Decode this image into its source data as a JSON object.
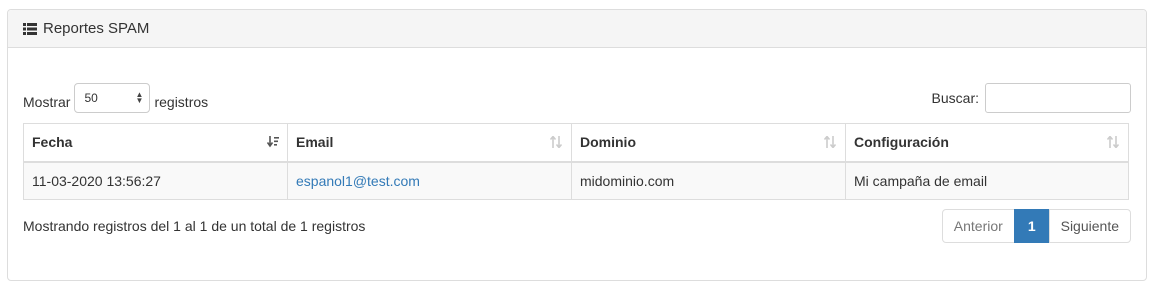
{
  "panel": {
    "title": "Reportes SPAM",
    "title_icon": "list-icon"
  },
  "length": {
    "prefix": "Mostrar",
    "value": "50",
    "suffix": "registros"
  },
  "filter": {
    "label": "Buscar:",
    "value": ""
  },
  "table": {
    "columns": [
      {
        "label": "Fecha",
        "sort": "sorted-desc"
      },
      {
        "label": "Email",
        "sort": "sortable"
      },
      {
        "label": "Dominio",
        "sort": "sortable"
      },
      {
        "label": "Configuración",
        "sort": "sortable"
      }
    ],
    "rows": [
      {
        "fecha": "11-03-2020 13:56:27",
        "email": "espanol1@test.com",
        "dominio": "midominio.com",
        "configuracion": "Mi campaña de email"
      }
    ]
  },
  "info": "Mostrando registros del 1 al 1 de un total de 1 registros",
  "pagination": {
    "previous": "Anterior",
    "current": "1",
    "next": "Siguiente"
  },
  "colors": {
    "accent": "#337ab7",
    "heading_bg": "#f5f5f5",
    "border": "#dddddd"
  }
}
